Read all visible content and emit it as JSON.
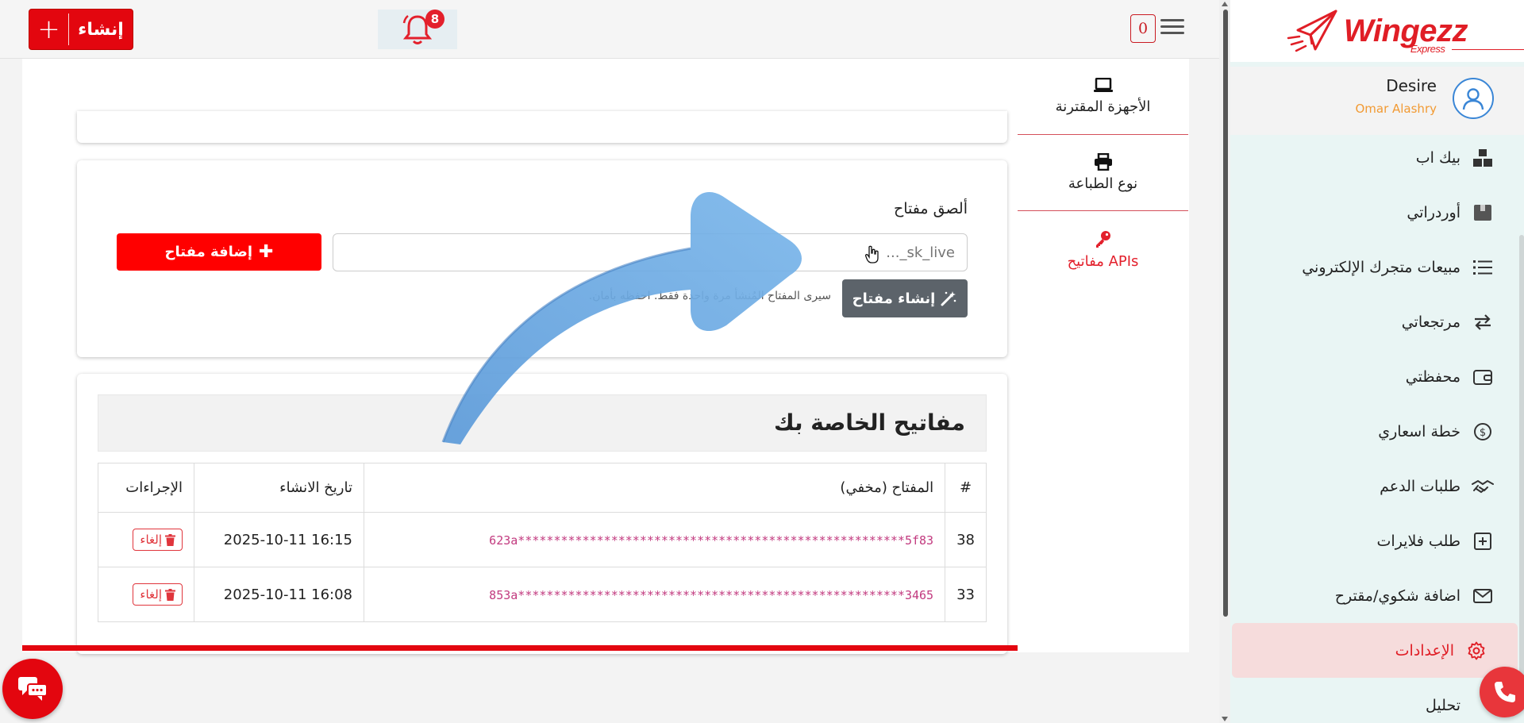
{
  "brand": {
    "name": "Wingezz",
    "sub": "Express",
    "accent": "#e01e26"
  },
  "user": {
    "name": "Desire",
    "subtitle": "Omar Alashry"
  },
  "sidebar": {
    "items": [
      {
        "label": "بيك اب",
        "icon": "boxes-icon"
      },
      {
        "label": "أوردراتي",
        "icon": "package-icon"
      },
      {
        "label": "مبيعات متجرك الإلكتروني",
        "icon": "list-icon"
      },
      {
        "label": "مرتجعاتي",
        "icon": "arrows-exchange-icon"
      },
      {
        "label": "محفظتي",
        "icon": "wallet-icon"
      },
      {
        "label": "خطة اسعاري",
        "icon": "dollar-circle-icon"
      },
      {
        "label": "طلبات الدعم",
        "icon": "handshake-icon"
      },
      {
        "label": "طلب فلايرات",
        "icon": "plus-square-icon"
      },
      {
        "label": "اضافة شكوي/مقترح",
        "icon": "envelope-icon"
      },
      {
        "label": "الإعدادات",
        "icon": "gear-icon"
      },
      {
        "label": "تحليل",
        "icon": "chart-icon"
      }
    ],
    "active_index": 9
  },
  "topbar": {
    "create_label": "إنشاء",
    "notifications_count": "8",
    "cart_count": "0"
  },
  "settings_tabs": [
    {
      "label": "الأجهزة المقترنة",
      "icon": "laptop-icon"
    },
    {
      "label": "نوع الطباعة",
      "icon": "printer-icon"
    },
    {
      "label": "مفاتيح APIs",
      "icon": "key-icon"
    }
  ],
  "key_form": {
    "paste_label": "ألصق مفتاح",
    "input_placeholder": "sk_live_...",
    "add_button": "إضافة مفتاح",
    "generate_button": "إنشاء مفتاح",
    "generate_hint": "سيرى المفتاح المُنشأ مرة واحدة فقط. احفظه بأمان."
  },
  "keys_table": {
    "title": "مفاتيح الخاصة بك",
    "columns": [
      "#",
      "المفتاح (مخفي)",
      "تاريخ الانشاء",
      "الإجراءات"
    ],
    "rows": [
      {
        "id": "38",
        "key": "623a******************************************************5f83",
        "created": "2025-10-11 16:15",
        "action": "إلغاء"
      },
      {
        "id": "33",
        "key": "853a******************************************************3465",
        "created": "2025-10-11 16:08",
        "action": "إلغاء"
      }
    ]
  }
}
